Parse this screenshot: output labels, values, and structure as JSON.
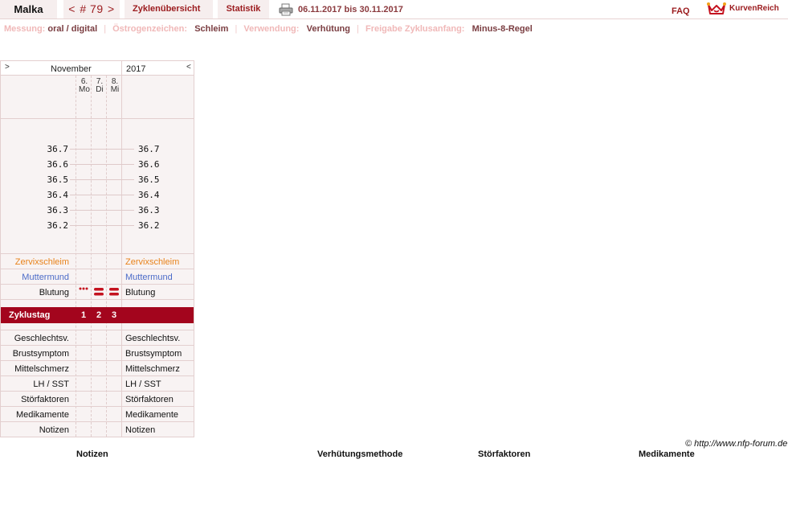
{
  "header": {
    "user": "Malka",
    "cycle_prev": "<",
    "cycle_label": "# 79",
    "cycle_next": ">",
    "tab_overview": "Zyklenübersicht",
    "tab_stats": "Statistik",
    "date_range": "06.11.2017 bis 30.11.2017",
    "faq": "FAQ",
    "logo_text": "KurvenReich"
  },
  "settings": {
    "measure_label": "Messung:",
    "measure_value": "oral / digital",
    "sign_label": "Östrogenzeichen:",
    "sign_value": "Schleim",
    "use_label": "Verwendung:",
    "use_value": "Verhütung",
    "release_label": "Freigabe Zyklusanfang:",
    "release_value": "Minus-8-Regel"
  },
  "chart": {
    "nav_prev": ">",
    "month": "November",
    "year": "2017",
    "nav_next": "<",
    "days": [
      {
        "num": "6.",
        "dow": "Mo"
      },
      {
        "num": "7.",
        "dow": "Di"
      },
      {
        "num": "8.",
        "dow": "Mi"
      }
    ],
    "temps": [
      "36.7",
      "36.6",
      "36.5",
      "36.4",
      "36.3",
      "36.2"
    ],
    "rows_top": [
      {
        "label": "Zervixschleim",
        "color": "#e8821a"
      },
      {
        "label": "Muttermund",
        "color": "#4b6bc8"
      },
      {
        "label": "Blutung",
        "color": "#111111"
      }
    ],
    "bleeding": [
      "spotting",
      "heavy",
      "heavy"
    ],
    "cycle_day_label": "Zyklustag",
    "cycle_days": [
      "1",
      "2",
      "3"
    ],
    "rows_bottom": [
      "Geschlechtsv.",
      "Brustsymptom",
      "Mittelschmerz",
      "LH / SST",
      "Störfaktoren",
      "Medikamente",
      "Notizen"
    ],
    "accent_color": "#a3051d"
  },
  "footer": {
    "copyright": "© http://www.nfp-forum.de",
    "legend": [
      "Notizen",
      "Verhütungsmethode",
      "Störfaktoren",
      "Medikamente"
    ]
  }
}
